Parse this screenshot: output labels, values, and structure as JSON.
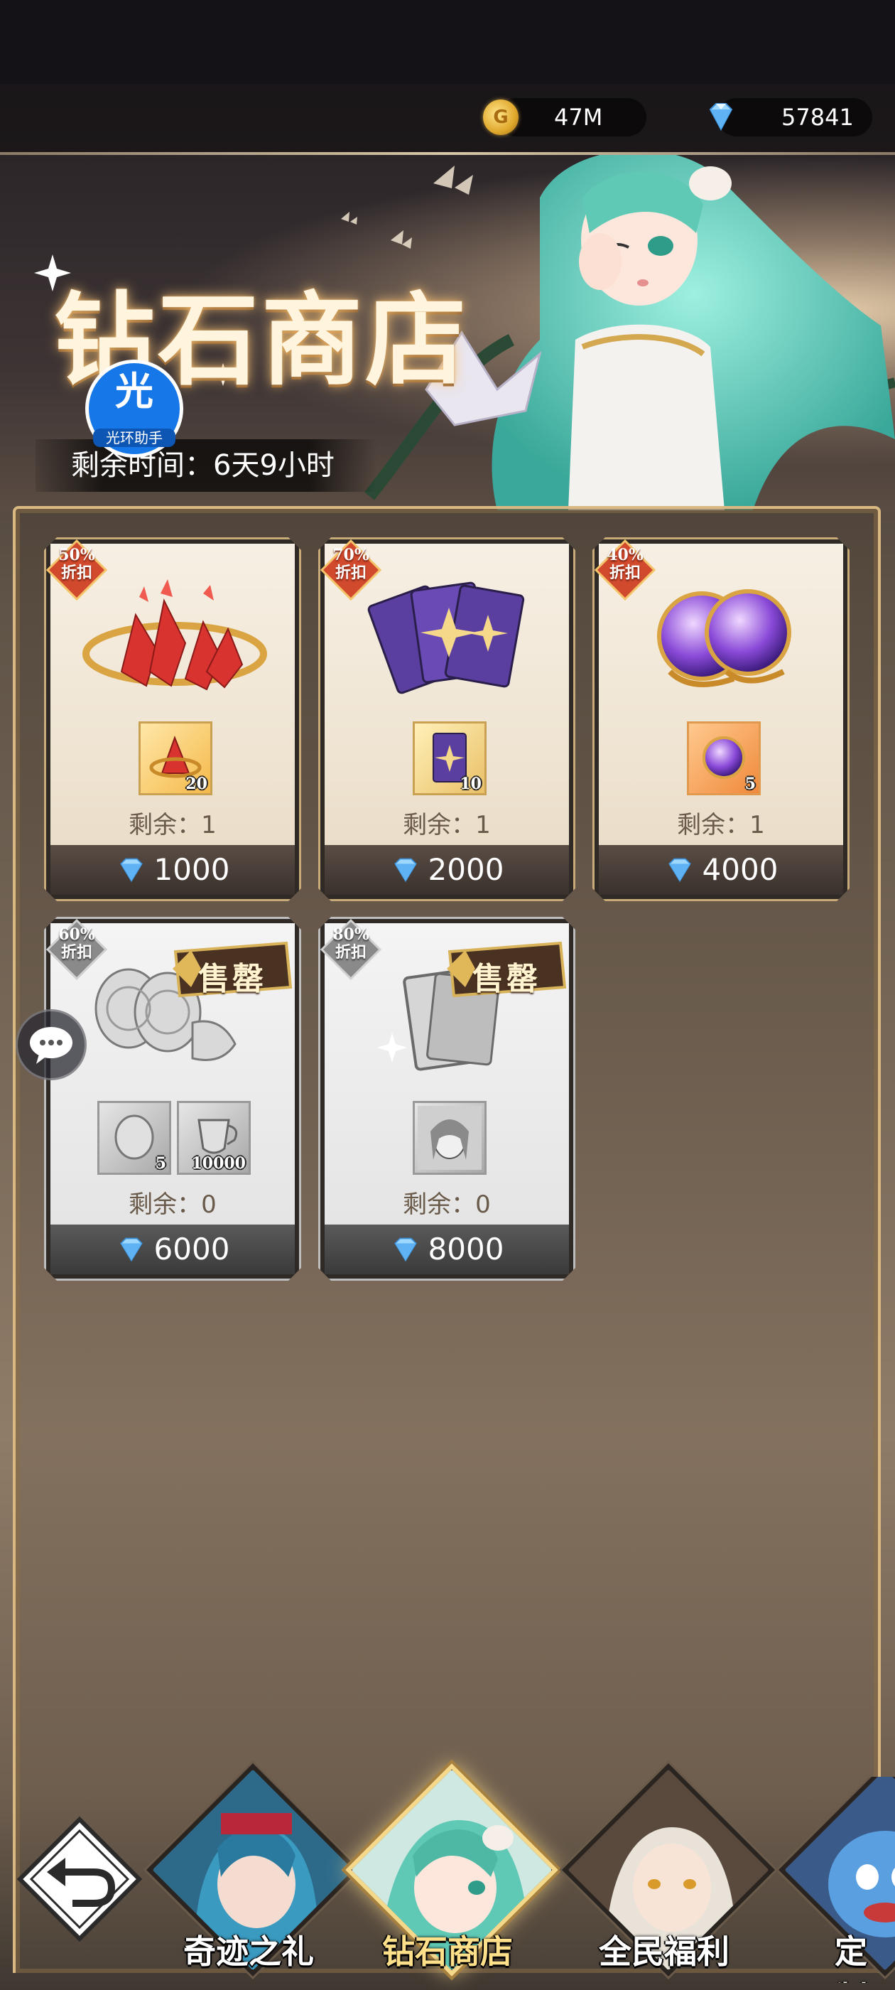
{
  "topbar": {
    "gold": "47M",
    "diamonds": "57841",
    "gold_icon": "coin-icon",
    "diamond_icon": "diamond-icon"
  },
  "banner": {
    "title": "钻石商店",
    "remaining_time": "剩余时间：6天9小时",
    "assistant_badge": "光",
    "assistant_label": "光环助手"
  },
  "items": [
    {
      "discount": "50%\n折扣",
      "discount_line1": "50%",
      "discount_line2": "折扣",
      "qty": [
        "20"
      ],
      "remain": "剩余：1",
      "price": "1000",
      "sold_out": false
    },
    {
      "discount_line1": "70%",
      "discount_line2": "折扣",
      "qty": [
        "10"
      ],
      "remain": "剩余：1",
      "price": "2000",
      "sold_out": false
    },
    {
      "discount_line1": "40%",
      "discount_line2": "折扣",
      "qty": [
        "5"
      ],
      "remain": "剩余：1",
      "price": "4000",
      "sold_out": false
    },
    {
      "discount_line1": "60%",
      "discount_line2": "折扣",
      "qty": [
        "5",
        "10000"
      ],
      "remain": "剩余：0",
      "price": "6000",
      "sold_out": true,
      "sold_label": "售罄"
    },
    {
      "discount_line1": "80%",
      "discount_line2": "折扣",
      "qty": [],
      "remain": "剩余：0",
      "price": "8000",
      "sold_out": true,
      "sold_label": "售罄"
    }
  ],
  "bottom_nav": {
    "tabs": [
      {
        "label": "奇迹之礼",
        "active": false
      },
      {
        "label": "钻石商店",
        "active": true
      },
      {
        "label": "全民福利",
        "active": false
      },
      {
        "label": "定制",
        "active": false
      }
    ]
  },
  "colors": {
    "accent_gold": "#d9b981",
    "active_tab": "#ffe08a",
    "assistant_blue": "#1677e8"
  }
}
